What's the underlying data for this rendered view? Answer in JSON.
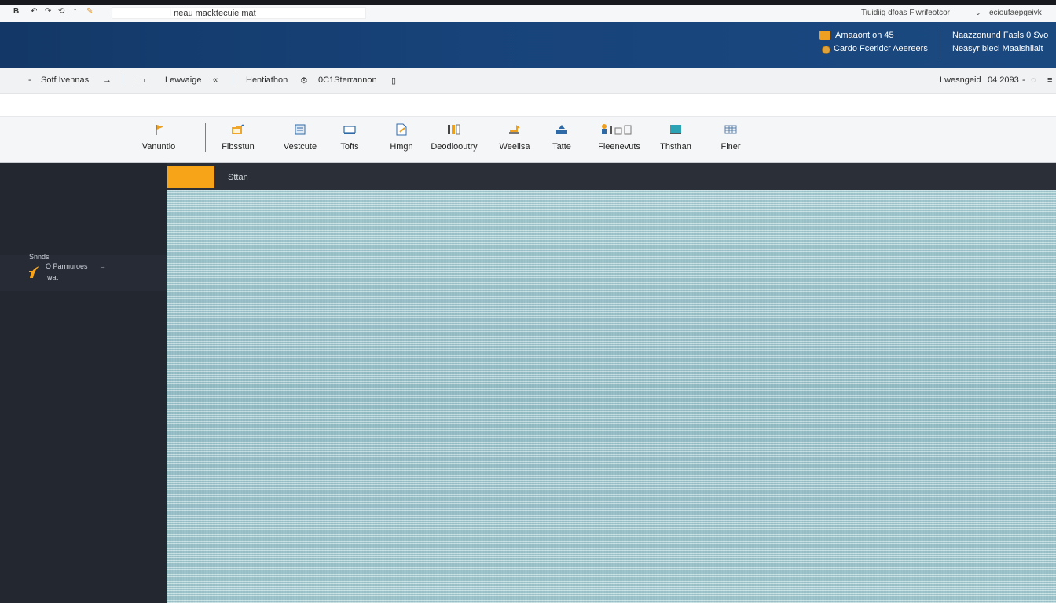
{
  "colors": {
    "header_bg": "#17437a",
    "accent": "#f7a418",
    "sidebar_bg": "#232730",
    "tabbar_bg": "#2b2f37",
    "canvas_bg": "#9fc9cf"
  },
  "titlebar": {
    "quick_access": [
      "B",
      "↶",
      "↷",
      "⟲",
      "↑"
    ],
    "address": "I neau macktecuie mat",
    "account_label_1": "Tiuidiig dfoas Fiwrifeotcor",
    "account_label_2": "ecioufaepgeivk"
  },
  "header": {
    "account_name": "Amaaont on 45",
    "account_sub": "Cardo Fcerldcr Aeereers",
    "region_title": "Naazzonund Fasls 0 Svo",
    "region_sub": "Neasyr bieci Maaishiialt"
  },
  "secnav": {
    "item_1": "Sotf Ivennas",
    "item_2": "Lewvaige",
    "item_3": "Hentiathon",
    "item_4": "0C1Sterrannon",
    "right_label": "Lwesngeid",
    "right_value": "04 2093"
  },
  "ribbon": {
    "items": [
      {
        "label": "Vanuntio",
        "icon": "flag-icon"
      },
      {
        "label": "Fibsstun",
        "icon": "folder-upload-icon"
      },
      {
        "label": "Vestcute",
        "icon": "document-icon"
      },
      {
        "label": "Tofts",
        "icon": "tray-icon"
      },
      {
        "label": "Hmgn",
        "icon": "page-edit-icon"
      },
      {
        "label": "Deodlooutry",
        "icon": "columns-icon"
      },
      {
        "label": "Weelisa",
        "icon": "tool-icon"
      },
      {
        "label": "Tatte",
        "icon": "upload-box-icon"
      },
      {
        "label": "Fleenevuts",
        "icon": "people-icon"
      },
      {
        "label": "Thsthan",
        "icon": "screen-icon"
      },
      {
        "label": "Flner",
        "icon": "grid-icon"
      }
    ]
  },
  "sidebar": {
    "group_label": "Snnds",
    "item_title": "O Parmuroes",
    "item_sub": "wat",
    "item_arrow": "→"
  },
  "tabbar": {
    "label": "Sttan"
  }
}
